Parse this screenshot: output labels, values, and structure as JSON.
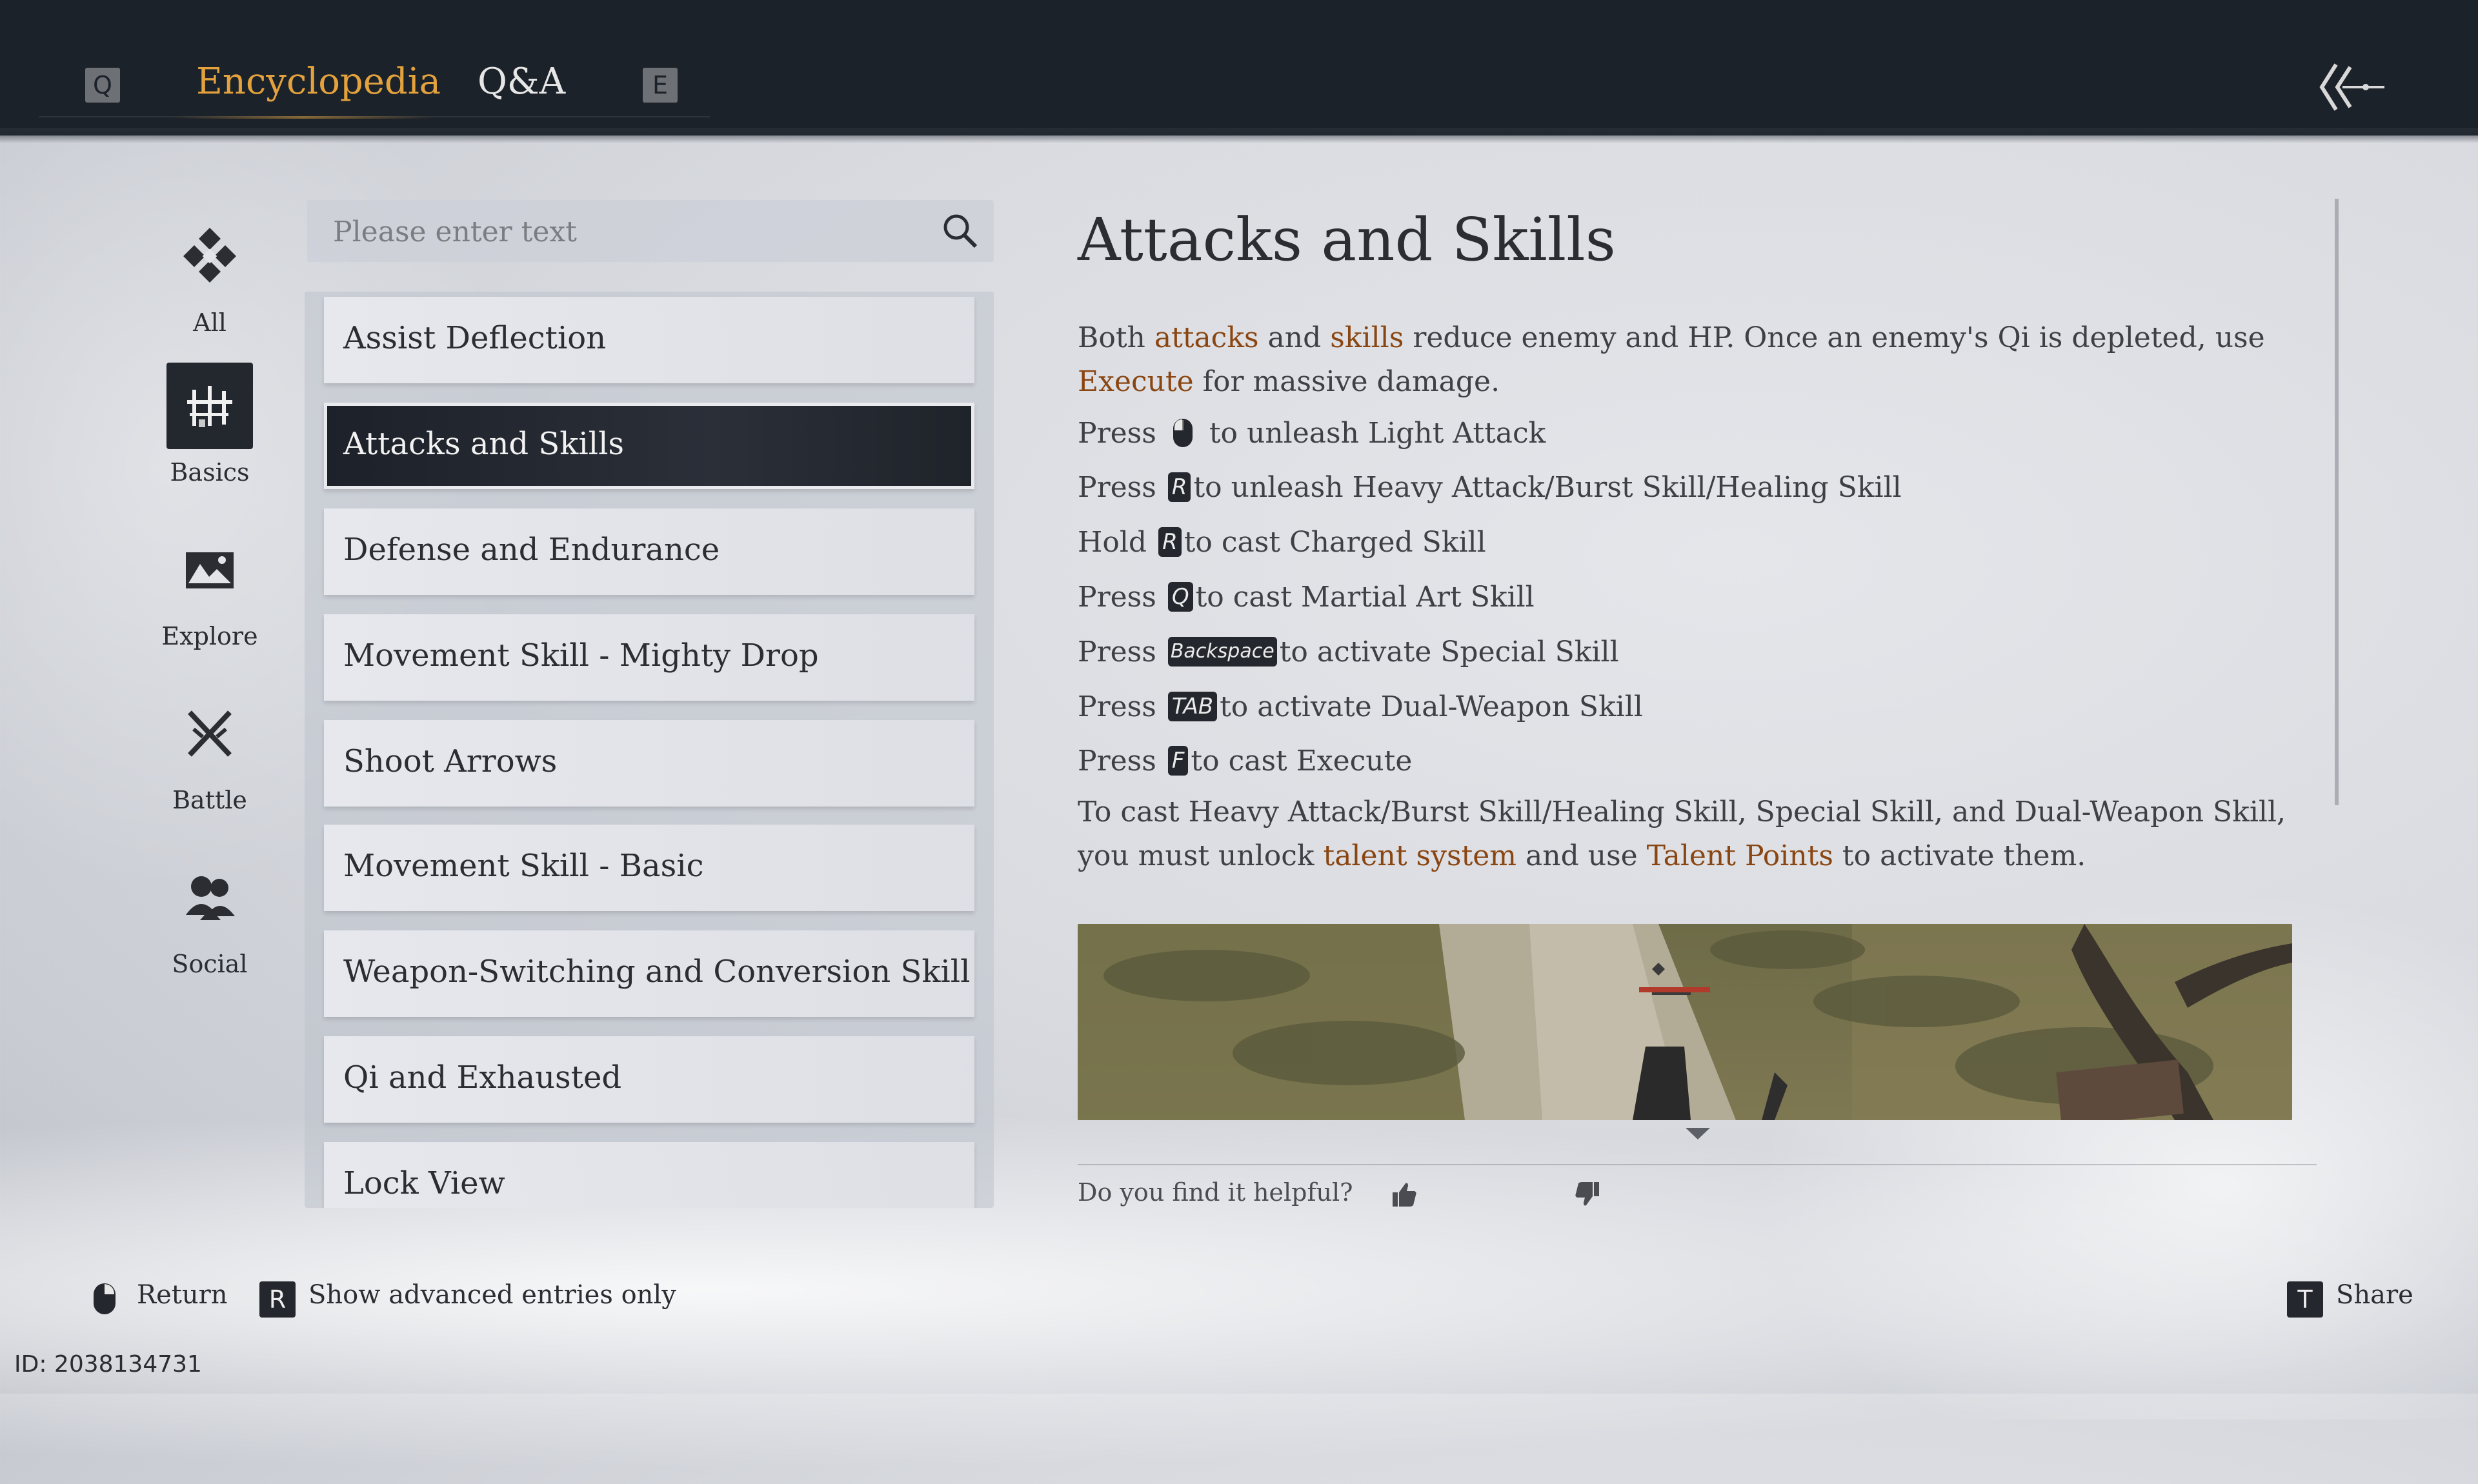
{
  "header": {
    "prev_key": "Q",
    "next_key": "E",
    "tabs": [
      {
        "label": "Encyclopedia",
        "active": true
      },
      {
        "label": "Q&A",
        "active": false
      }
    ],
    "accent_color": "#e3a23d"
  },
  "categories": [
    {
      "label": "All",
      "icon": "all-diamond-icon"
    },
    {
      "label": "Basics",
      "icon": "basics-icon",
      "selected": true
    },
    {
      "label": "Explore",
      "icon": "explore-landscape-icon"
    },
    {
      "label": "Battle",
      "icon": "crossed-swords-icon"
    },
    {
      "label": "Social",
      "icon": "social-people-icon"
    }
  ],
  "search": {
    "placeholder": "Please enter text"
  },
  "entries": [
    "Assist Deflection",
    "Attacks and Skills",
    "Defense and Endurance",
    "Movement Skill - Mighty Drop",
    "Shoot Arrows",
    "Movement Skill - Basic",
    "Weapon-Switching and Conversion Skill",
    "Qi and Exhausted",
    "Lock View"
  ],
  "selected_entry": "Attacks and Skills",
  "article": {
    "title": "Attacks and Skills",
    "intro": {
      "p1": "Both ",
      "h1": "attacks",
      "p2": " and ",
      "h2": "skills",
      "p3": " reduce enemy and HP. Once an enemy's Qi is depleted, use ",
      "h3": "Execute",
      "p4": " for massive damage."
    },
    "controls": [
      {
        "verb": "Press",
        "key": "mouse-left-icon",
        "text": "to unleash Light Attack"
      },
      {
        "verb": "Press",
        "key": "R",
        "text": "to unleash Heavy Attack/Burst Skill/Healing Skill"
      },
      {
        "verb": "Hold",
        "key": "R",
        "text": "to cast Charged Skill"
      },
      {
        "verb": "Press",
        "key": "Q",
        "text": "to cast Martial Art Skill"
      },
      {
        "verb": "Press",
        "key": "Backspace",
        "text": "to activate Special Skill"
      },
      {
        "verb": "Press",
        "key": "TAB",
        "text": "to activate Dual-Weapon Skill"
      },
      {
        "verb": "Press",
        "key": "F",
        "text": "to cast Execute"
      }
    ],
    "outro": {
      "p1": "To cast Heavy Attack/Burst Skill/Healing Skill, Special Skill, and Dual-Weapon Skill, you must unlock ",
      "h1": "talent system",
      "p2": " and use ",
      "h2": "Talent Points",
      "p3": " to activate them."
    },
    "highlight_color": "#8a4612"
  },
  "feedback": {
    "question": "Do you find it helpful?"
  },
  "footer": {
    "return_label": "Return",
    "advanced_key": "R",
    "advanced_label": "Show advanced entries only",
    "share_key": "T",
    "share_label": "Share",
    "uid": "ID: 2038134731"
  }
}
